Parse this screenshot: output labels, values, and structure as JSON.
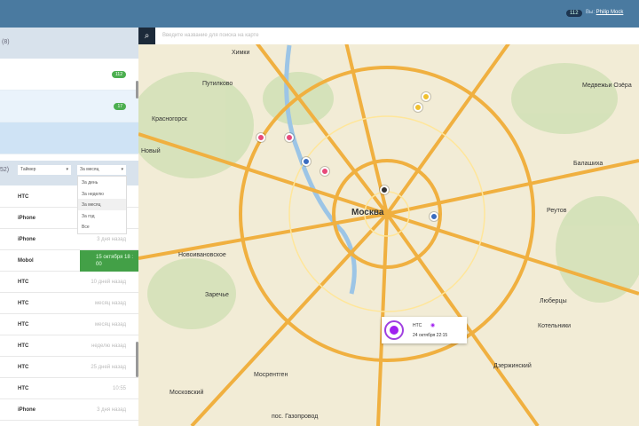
{
  "header": {
    "badge": "112",
    "user_prefix": "Вы:",
    "user_name": "Philip Mock"
  },
  "sidebar": {
    "title": "(8)",
    "groups": [
      {
        "count": "112"
      },
      {
        "count": "17"
      },
      {
        "count": ""
      }
    ],
    "filter": {
      "total": "52)",
      "type": "Таймер",
      "period": "За месяц",
      "period_options": [
        "За день",
        "За неделю",
        "За месяц",
        "За год",
        "Все"
      ]
    },
    "rows": [
      {
        "name": "HTC",
        "time": ""
      },
      {
        "name": "iPhone",
        "time": ""
      },
      {
        "name": "iPhone",
        "time": "3 дня назад"
      },
      {
        "name": "Mobol",
        "time": "15 октября 18 : 00",
        "highlight": true
      },
      {
        "name": "HTC",
        "time": "10 дней назад"
      },
      {
        "name": "HTC",
        "time": "месяц назад"
      },
      {
        "name": "HTC",
        "time": "месяц назад"
      },
      {
        "name": "HTC",
        "time": "неделю назад"
      },
      {
        "name": "HTC",
        "time": "25 дней назад"
      },
      {
        "name": "HTC",
        "time": "10:55"
      },
      {
        "name": "iPhone",
        "time": "3 дня назад"
      }
    ]
  },
  "map": {
    "search_placeholder": "Введите название для поиска на карте",
    "labels": [
      "Химки",
      "Путилково",
      "Красногорск",
      "Москва",
      "Балашиха",
      "Реутов",
      "Люберцы",
      "Котельники",
      "Дзержинский",
      "Московский",
      "Мосрентген",
      "Новый",
      "Медвежьи Озёра",
      "Новоивановское",
      "Заречье",
      "пос. Газопровод",
      "Красногорск"
    ],
    "popup": {
      "device": "HTC",
      "date": "24 октября 22:15"
    }
  }
}
